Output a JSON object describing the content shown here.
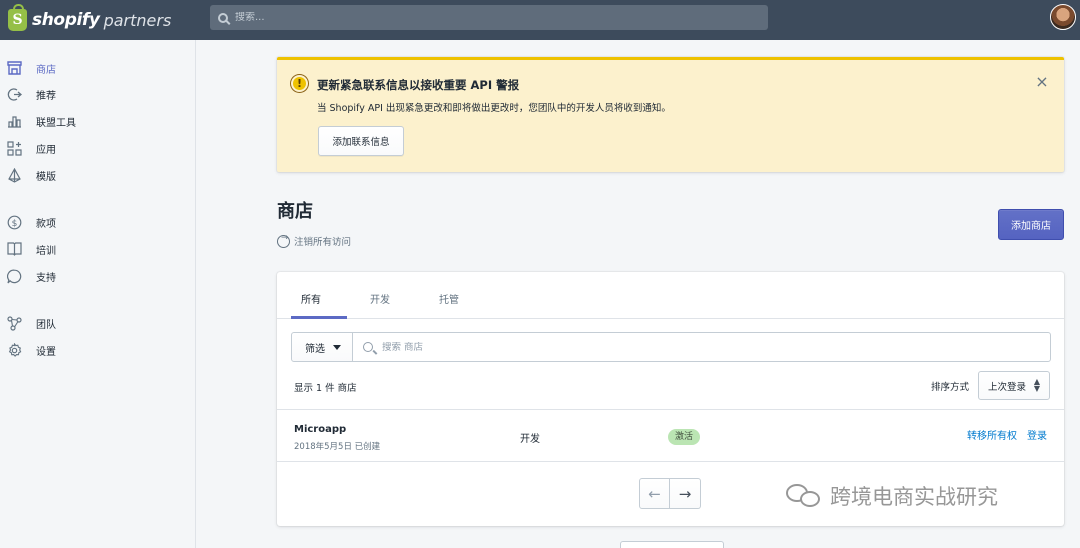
{
  "topbar": {
    "logo_word": "shopify",
    "logo_partners": "partners",
    "search_placeholder": "搜索..."
  },
  "sidebar": {
    "items": [
      {
        "label": "商店",
        "icon": "store-icon",
        "active": true
      },
      {
        "label": "推荐",
        "icon": "referral-icon"
      },
      {
        "label": "联盟工具",
        "icon": "affiliate-chart-icon"
      },
      {
        "label": "应用",
        "icon": "apps-icon"
      },
      {
        "label": "模版",
        "icon": "themes-icon"
      },
      {
        "label": "款项",
        "icon": "payouts-icon"
      },
      {
        "label": "培训",
        "icon": "education-icon"
      },
      {
        "label": "支持",
        "icon": "support-icon"
      },
      {
        "label": "团队",
        "icon": "team-icon"
      },
      {
        "label": "设置",
        "icon": "settings-icon"
      }
    ]
  },
  "banner": {
    "title": "更新紧急联系信息以接收重要 API 警报",
    "text": "当 Shopify API 出现紧急更改和即将做出更改时，您团队中的开发人员将收到通知。",
    "button": "添加联系信息",
    "close": "×"
  },
  "page": {
    "title": "商店",
    "revoke": "注销所有访问",
    "add_store": "添加商店"
  },
  "tabs": [
    "所有",
    "开发",
    "托管"
  ],
  "filter": {
    "button": "筛选",
    "search_placeholder": "搜索 商店"
  },
  "list": {
    "count": "显示 1 件 商店",
    "sort_label": "排序方式",
    "sort_value": "上次登录"
  },
  "stores": [
    {
      "name": "Microapp",
      "created": "2018年5月5日 已创建",
      "type": "开发",
      "status": "激活",
      "transfer": "转移所有权",
      "login": "登录"
    }
  ],
  "pager": {
    "prev": "←",
    "next": "→"
  },
  "watermark": "跨境电商实战研究",
  "colors": {
    "topbar": "#3d4b5c",
    "accent": "#5c6ac4",
    "banner_bg": "#fcf1cd",
    "banner_border": "#eec200",
    "badge_green": "#bbe5b3",
    "link": "#007ace"
  }
}
